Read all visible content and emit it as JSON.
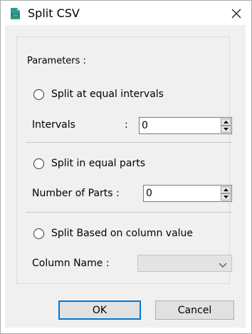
{
  "window": {
    "title": "Split CSV"
  },
  "icons": {
    "app": "csv-file-icon",
    "close": "close-icon"
  },
  "parameters": {
    "group_title": "Parameters :",
    "equal_intervals": {
      "radio_label": "Split at equal intervals",
      "field_label": "Intervals",
      "colon": ":",
      "value": "0"
    },
    "equal_parts": {
      "radio_label": "Split in equal parts",
      "field_label": "Number of Parts :",
      "value": "0"
    },
    "column_value": {
      "radio_label": "Split Based on column value",
      "field_label": "Column Name :",
      "selected": ""
    }
  },
  "buttons": {
    "ok": "OK",
    "cancel": "Cancel"
  },
  "colors": {
    "accent": "#0078d7",
    "icon_teal": "#2e9c8f",
    "client_bg": "#f0f0f0"
  }
}
